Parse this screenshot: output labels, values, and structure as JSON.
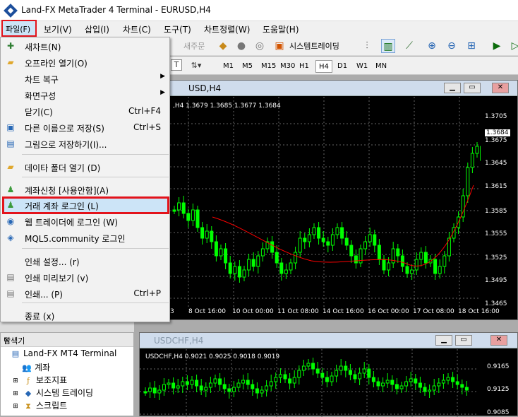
{
  "window": {
    "title": "Land-FX MetaTrader 4 Terminal - EURUSD,H4"
  },
  "menubar": [
    "파일(F)",
    "보기(V)",
    "삽입(I)",
    "차트(C)",
    "도구(T)",
    "차트정렬(W)",
    "도움말(H)"
  ],
  "toolbar": {
    "new_order": "새주문",
    "auto_trading": "시스템트레이딩",
    "timeframes": [
      "M1",
      "M5",
      "M15",
      "M30",
      "H1",
      "H4",
      "D1",
      "W1",
      "MN"
    ],
    "selected_timeframe": "H4"
  },
  "file_menu": {
    "items": [
      {
        "label": "새차트(N)",
        "shortcut": "",
        "icon": "new-chart-icon"
      },
      {
        "label": "오프라인 열기(O)",
        "shortcut": "",
        "icon": "folder-open-icon"
      },
      {
        "label": "차트 복구",
        "shortcut": "",
        "icon": ""
      },
      {
        "label": "화면구성",
        "shortcut": "",
        "icon": ""
      },
      {
        "label": "닫기(C)",
        "shortcut": "Ctrl+F4",
        "icon": ""
      },
      {
        "label": "다른 이름으로 저장(S)",
        "shortcut": "Ctrl+S",
        "icon": "save-icon"
      },
      {
        "label": "그림으로 저장하기(I)...",
        "shortcut": "",
        "icon": "save-picture-icon"
      },
      {
        "label": "데이타 폴더 열기 (D)",
        "shortcut": "",
        "icon": "data-folder-icon"
      },
      {
        "label": "계좌신청 [사용안함](A)",
        "shortcut": "",
        "icon": "open-account-icon"
      },
      {
        "label": "거래 계좌 로그인 (L)",
        "shortcut": "",
        "icon": "login-trade-account-icon"
      },
      {
        "label": "웹 트레이더에 로그인 (W)",
        "shortcut": "",
        "icon": "web-trader-icon"
      },
      {
        "label": "MQL5.community 로그인",
        "shortcut": "",
        "icon": "mql5-icon"
      },
      {
        "label": "인쇄 설정... (r)",
        "shortcut": "",
        "icon": ""
      },
      {
        "label": "인쇄 미리보기 (v)",
        "shortcut": "",
        "icon": "print-preview-icon"
      },
      {
        "label": "인쇄... (P)",
        "shortcut": "Ctrl+P",
        "icon": "print-icon"
      },
      {
        "label": "종료 (x)",
        "shortcut": "",
        "icon": ""
      }
    ]
  },
  "chart1": {
    "title": "USD,H4",
    "info": ",H4  1.3679 1.3685 1.3677 1.3684",
    "price_labels": [
      "1.3705",
      "1.3684",
      "1.3675",
      "1.3645",
      "1.3615",
      "1.3585",
      "1.3555",
      "1.3525",
      "1.3495",
      "1.3465"
    ],
    "time_labels": [
      "3",
      "8 Oct 16:00",
      "10 Oct 00:00",
      "11 Oct 08:00",
      "14 Oct 16:00",
      "16 Oct 00:00",
      "17 Oct 08:00",
      "18 Oct 16:00"
    ]
  },
  "chart2": {
    "title": "USDCHF,H4",
    "info": "USDCHF,H4  0.9021 0.9025 0.9018 0.9019",
    "price_labels": [
      "0.9165",
      "0.9125",
      "0.9085"
    ]
  },
  "navigator": {
    "title": "탐색기",
    "root": "Land-FX MT4 Terminal",
    "items": [
      "계좌",
      "보조지표",
      "시스템 트레이딩",
      "스크립트"
    ]
  },
  "colors": {
    "highlight_border": "#e3131b",
    "candle": "#00ff00",
    "ma": "#ff0000",
    "chart_bg": "#000000"
  }
}
